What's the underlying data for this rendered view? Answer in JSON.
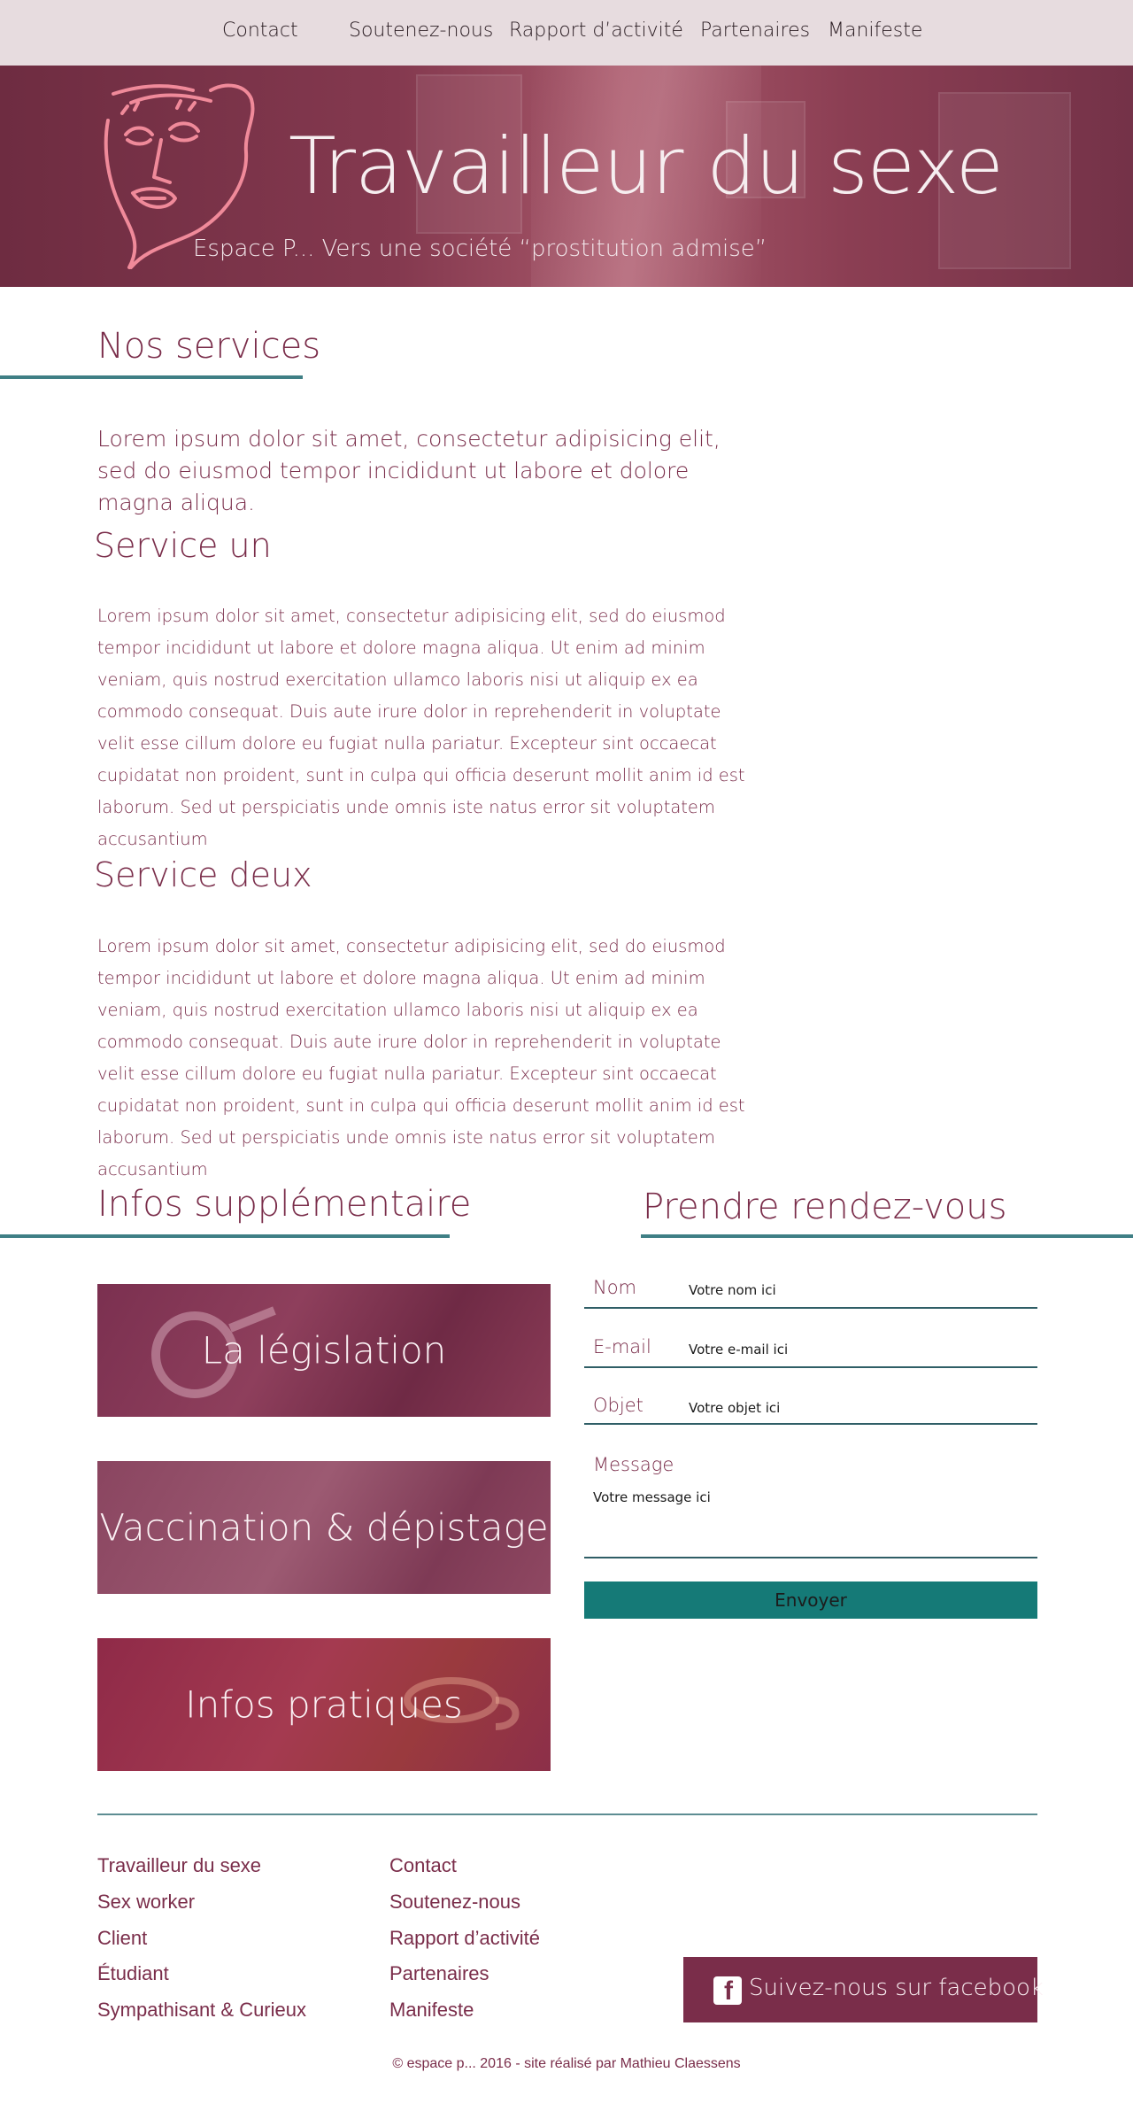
{
  "nav": {
    "items": [
      "Contact",
      "Soutenez-nous",
      "Rapport d’activité",
      "Partenaires",
      "Manifeste"
    ]
  },
  "hero": {
    "title": "Travailleur du sexe",
    "subtitle": "Espace P... Vers une société “prostitution admise”",
    "logo_icon": "face-sketch-logo"
  },
  "services": {
    "title": "Nos services",
    "lead": "Lorem ipsum dolor sit amet, consectetur adipisicing elit, sed do eiusmod tempor incididunt ut labore et dolore magna aliqua.",
    "items": [
      {
        "title": "Service un",
        "text": "Lorem ipsum dolor sit amet, consectetur adipisicing elit, sed do eiusmod tempor incididunt ut labore et dolore magna aliqua. Ut enim ad minim veniam, quis nostrud exercitation ullamco laboris nisi ut aliquip ex ea commodo consequat. Duis aute irure dolor in reprehenderit in voluptate velit esse cillum dolore eu fugiat nulla pariatur. Excepteur sint occaecat cupidatat non proident, sunt in culpa qui officia deserunt mollit anim id est laborum. Sed ut perspiciatis unde omnis iste natus error sit voluptatem accusantium"
      },
      {
        "title": "Service deux",
        "text": "Lorem ipsum dolor sit amet, consectetur adipisicing elit, sed do eiusmod tempor incididunt ut labore et dolore magna aliqua. Ut enim ad minim veniam, quis nostrud exercitation ullamco laboris nisi ut aliquip ex ea commodo consequat. Duis aute irure dolor in reprehenderit in voluptate velit esse cillum dolore eu fugiat nulla pariatur. Excepteur sint occaecat cupidatat non proident, sunt in culpa qui officia deserunt mollit anim id est laborum. Sed ut perspiciatis unde omnis iste natus error sit voluptatem accusantium"
      }
    ]
  },
  "infos": {
    "title": "Infos supplémentaire",
    "cards": [
      "La législation",
      "Vaccination & dépistage",
      "Infos pratiques"
    ]
  },
  "rdv": {
    "title": "Prendre rendez-vous",
    "fields": {
      "name": {
        "label": "Nom",
        "placeholder": "Votre nom ici"
      },
      "email": {
        "label": "E-mail",
        "placeholder": "Votre e-mail ici"
      },
      "subject": {
        "label": "Objet",
        "placeholder": "Votre objet ici"
      },
      "message": {
        "label": "Message",
        "placeholder": "Votre message ici"
      }
    },
    "submit_label": "Envoyer"
  },
  "footer": {
    "col1": [
      "Travailleur du sexe",
      "Sex worker",
      "Client",
      "Étudiant",
      "Sympathisant & Curieux"
    ],
    "col2": [
      "Contact",
      "Soutenez-nous",
      "Rapport d’activité",
      "Partenaires",
      "Manifeste"
    ],
    "facebook_label": "Suivez-nous sur facebook",
    "facebook_icon": "facebook-icon",
    "copyright": "© espace p... 2016 - site réalisé par Mathieu Claessens"
  },
  "colors": {
    "brand": "#7a2d4a",
    "accent_teal": "#157a77",
    "rule": "#3f7f85",
    "nav_bg": "#e7dcdf"
  }
}
